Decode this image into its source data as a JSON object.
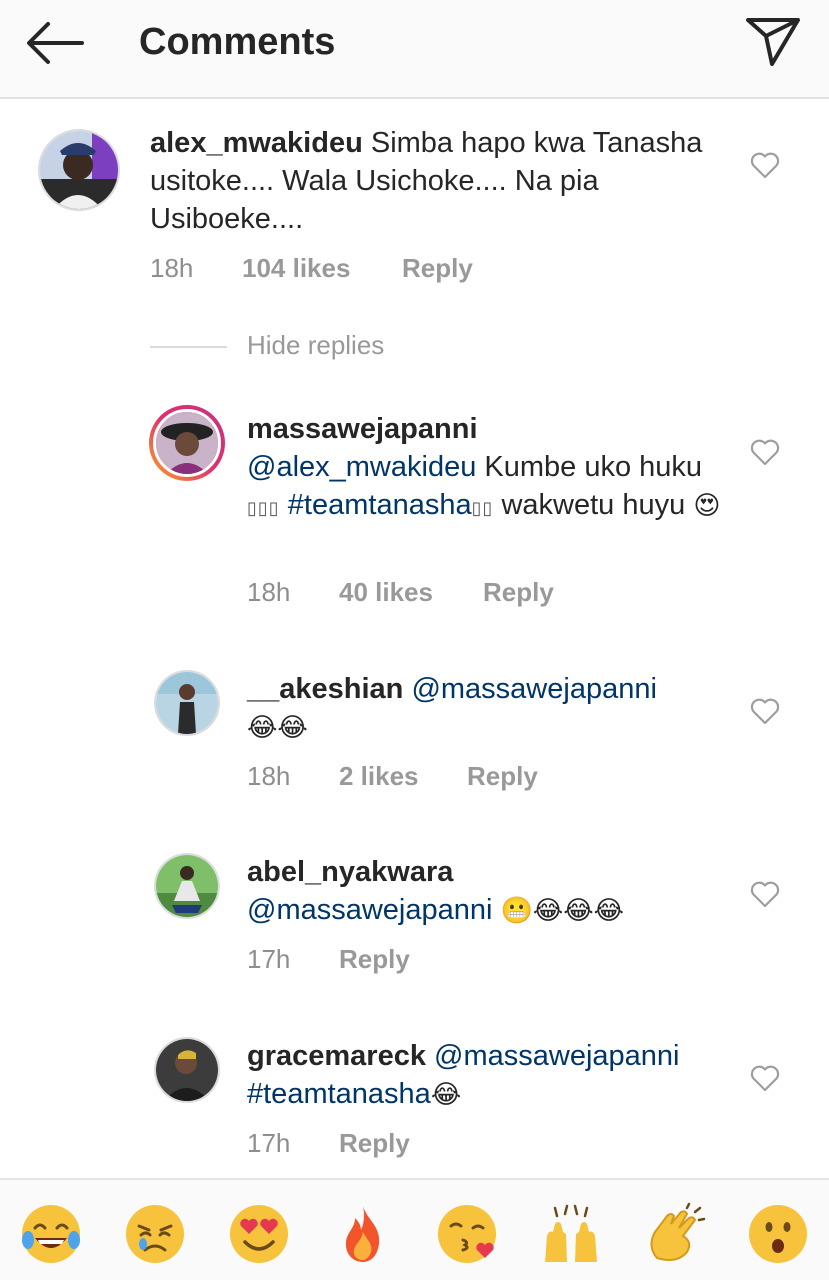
{
  "header": {
    "title": "Comments"
  },
  "comments": [
    {
      "username": "alex_mwakideu",
      "text": "Simba hapo kwa Tanasha usitoke.... Wala Usichoke.... Na pia Usiboeke....",
      "time": "18h",
      "likes": "104 likes",
      "reply": "Reply"
    }
  ],
  "hide_replies": "Hide replies",
  "replies": [
    {
      "username": "massawejapanni",
      "mention": "@alex_mwakideu",
      "text_a": "Kumbe uko huku",
      "hashtag": "#teamtanasha",
      "text_b": "wakwetu huyu",
      "emoji": "😍",
      "time": "18h",
      "likes": "40 likes",
      "reply": "Reply"
    },
    {
      "username": "__akeshian",
      "mention": "@massawejapanni",
      "emoji": "😂😂",
      "time": "18h",
      "likes": "2 likes",
      "reply": "Reply"
    },
    {
      "username": "abel_nyakwara",
      "mention": "@massawejapanni",
      "emoji": "😬😂😂😂",
      "time": "17h",
      "reply": "Reply"
    },
    {
      "username": "gracemareck",
      "mention": "@massawejapanni",
      "hashtag": "#teamtanasha",
      "emoji": "😂",
      "time": "17h",
      "reply": "Reply"
    }
  ],
  "emoji_bar": [
    {
      "icon": "tears-of-joy-icon",
      "char": "😂"
    },
    {
      "icon": "crying-face-icon",
      "char": "😢"
    },
    {
      "icon": "heart-eyes-icon",
      "char": "😍"
    },
    {
      "icon": "fire-icon",
      "char": "🔥"
    },
    {
      "icon": "kissing-heart-icon",
      "char": "😘"
    },
    {
      "icon": "raised-hands-icon",
      "char": "🙌"
    },
    {
      "icon": "clapping-hands-icon",
      "char": "👏"
    },
    {
      "icon": "surprised-face-icon",
      "char": "😮"
    }
  ],
  "colors": {
    "text": "#262626",
    "mention": "#003569",
    "meta": "#8e8e8e",
    "emoji_yellow": "#f7c33c"
  }
}
